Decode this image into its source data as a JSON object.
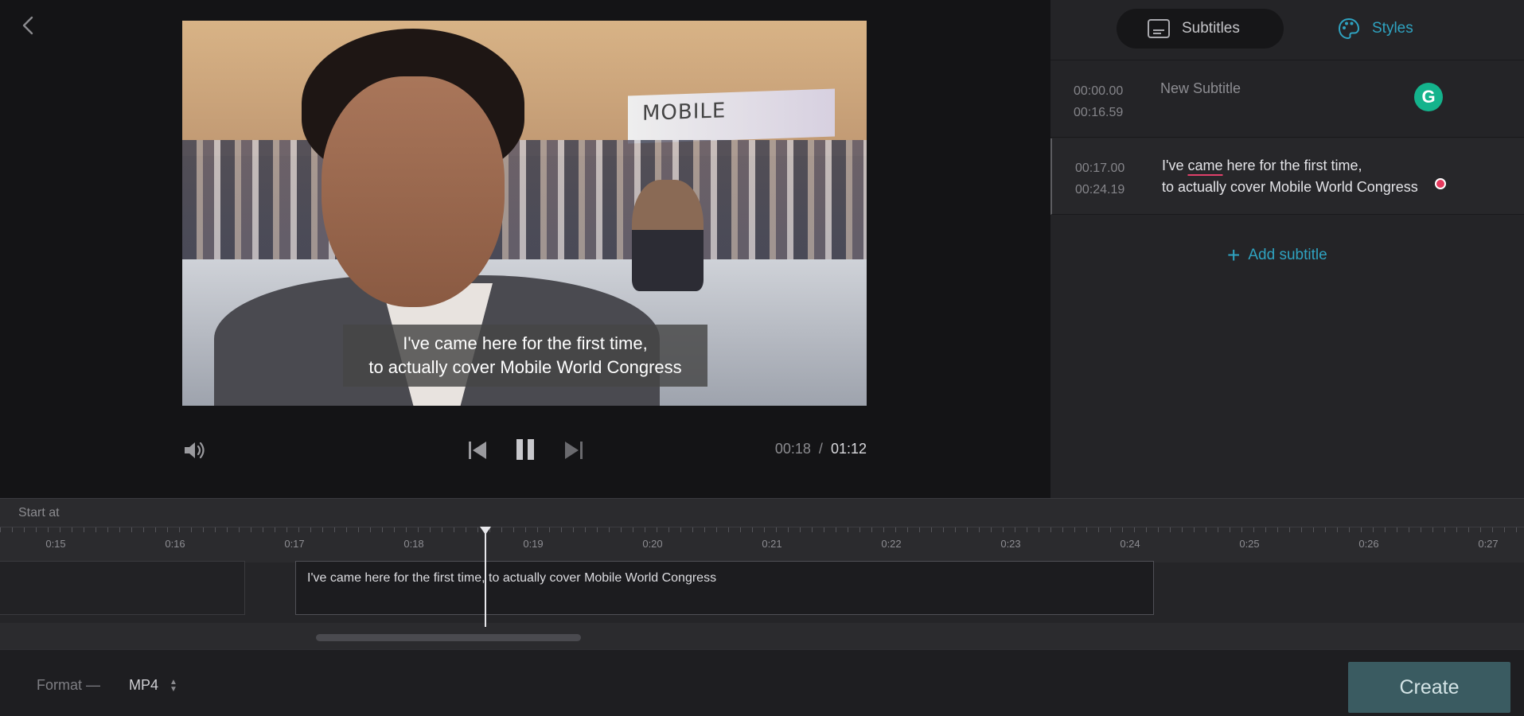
{
  "player": {
    "caption_line1": "I've came here for the first time,",
    "caption_line2": "to actually cover Mobile World Congress",
    "current_time": "00:18",
    "separator": "/",
    "total_time": "01:12",
    "scene_sign": "MOBILE"
  },
  "tabs": [
    {
      "label": "Subtitles",
      "icon": "subtitles-icon"
    },
    {
      "label": "Styles",
      "icon": "palette-icon"
    }
  ],
  "subtitles": [
    {
      "start": "00:00.00",
      "end": "00:16.59",
      "text": "New Subtitle"
    },
    {
      "start": "00:17.00",
      "end": "00:24.19",
      "line1_pre": "I've ",
      "line1_word": "came",
      "line1_post": " here for the first time,",
      "line2": "to actually cover Mobile World Congress"
    }
  ],
  "grammarly_badge": "G",
  "add_subtitle_label": "Add subtitle",
  "timeline": {
    "start_at_label": "Start at",
    "ticks": [
      "0:15",
      "0:16",
      "0:17",
      "0:18",
      "0:19",
      "0:20",
      "0:21",
      "0:22",
      "0:23",
      "0:24",
      "0:25",
      "0:26",
      "0:27"
    ],
    "clip_text": "I've came here for the first time, to actually cover Mobile World Congress"
  },
  "bottom": {
    "format_label": "Format —",
    "format_value": "MP4",
    "create_label": "Create"
  },
  "colors": {
    "accent": "#2fa3c1",
    "create_button": "#3a5b61",
    "grammarly": "#14b38c",
    "spell_error": "#e0416b"
  }
}
